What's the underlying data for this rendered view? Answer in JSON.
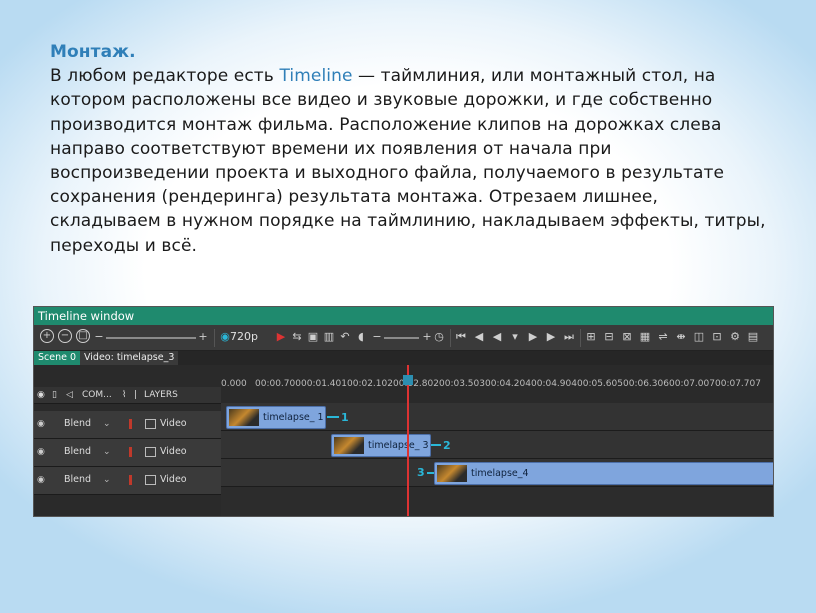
{
  "doc": {
    "heading": "Монтаж.",
    "line1_prefix": "В любом редакторе есть ",
    "line1_accent": "Timeline",
    "paragraph": " — таймлиния, или монтажный стол, на котором расположены все видео и звуковые дорожки, и где собственно производится монтаж фильма. Расположение клипов на дорожках слева направо соответствуют времени их появления от начала при воспроизведении проекта и выходного файла, получаемого в результате сохранения (рендеринга) результата монтажа. Отрезаем лишнее, складываем в нужном порядке на таймлинию, накладываем эффекты, титры, переходы и всё."
  },
  "window": {
    "title": "Timeline window",
    "quality": "720p",
    "scene_tab": "Scene 0",
    "video_tab": "Video: timelapse_3",
    "header": {
      "com": "COM...",
      "layers": "LAYERS"
    },
    "tracks": [
      {
        "blend": "Blend",
        "name": "Video"
      },
      {
        "blend": "Blend",
        "name": "Video"
      },
      {
        "blend": "Blend",
        "name": "Video"
      }
    ],
    "ruler_ticks": [
      "0.000",
      "00:00.700",
      "00:01.401",
      "00:02.102",
      "00:02.802",
      "00:03.503",
      "00:04.204",
      "00:04.904",
      "00:05.605",
      "00:06.306",
      "00:07.007",
      "00:07.707"
    ],
    "clips": [
      {
        "name": "timelapse_ 1",
        "marker": "1"
      },
      {
        "name": "timelapse_ 3",
        "marker": "2"
      },
      {
        "name": "timelapse_4",
        "marker": "3"
      }
    ]
  }
}
